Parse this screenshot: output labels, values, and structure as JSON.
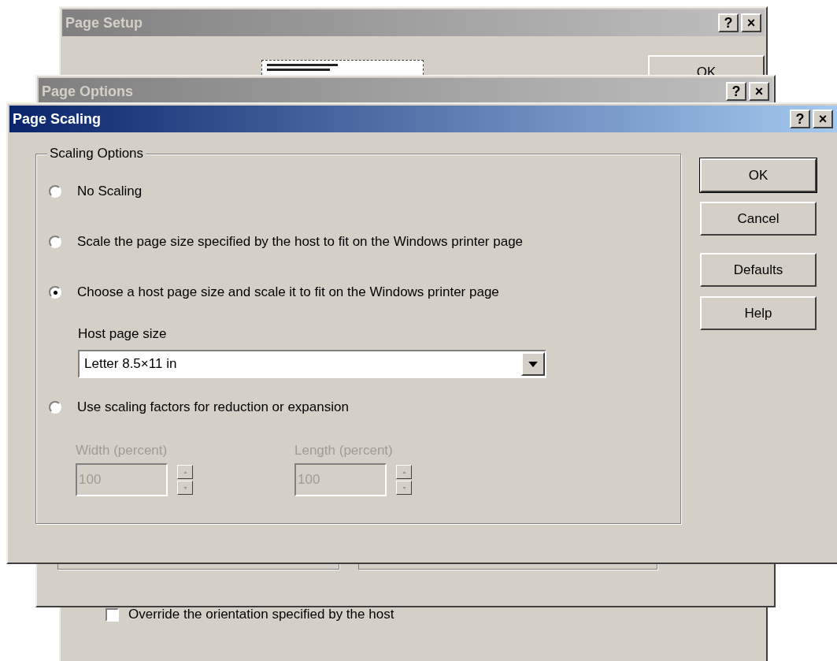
{
  "page_setup": {
    "title": "Page Setup",
    "active": false,
    "caption_buttons": [
      "?",
      "×"
    ],
    "ok_button": "OK",
    "orientation_checkbox": {
      "label": "Override the orientation specified by the host",
      "checked": false
    }
  },
  "page_options": {
    "title": "Page Options",
    "active": false,
    "caption_buttons": [
      "?",
      "×"
    ]
  },
  "page_scaling": {
    "title": "Page Scaling",
    "active": true,
    "caption_buttons": [
      "?",
      "×"
    ],
    "group_title": "Scaling Options",
    "options": [
      {
        "label": "No Scaling",
        "selected": false
      },
      {
        "label": "Scale the page size specified by the host to fit on the Windows printer page",
        "selected": false
      },
      {
        "label": "Choose a host page size and scale it to fit on the Windows printer page",
        "selected": true
      },
      {
        "label": "Use scaling factors for reduction or expansion",
        "selected": false
      }
    ],
    "host_page_size": {
      "label": "Host page size",
      "value": "Letter 8.5×11 in"
    },
    "factors": [
      {
        "label": "Width (percent)",
        "value": "100",
        "disabled": true
      },
      {
        "label": "Length (percent)",
        "value": "100",
        "disabled": true
      }
    ],
    "buttons": [
      "OK",
      "Cancel",
      "Defaults",
      "Help"
    ]
  }
}
